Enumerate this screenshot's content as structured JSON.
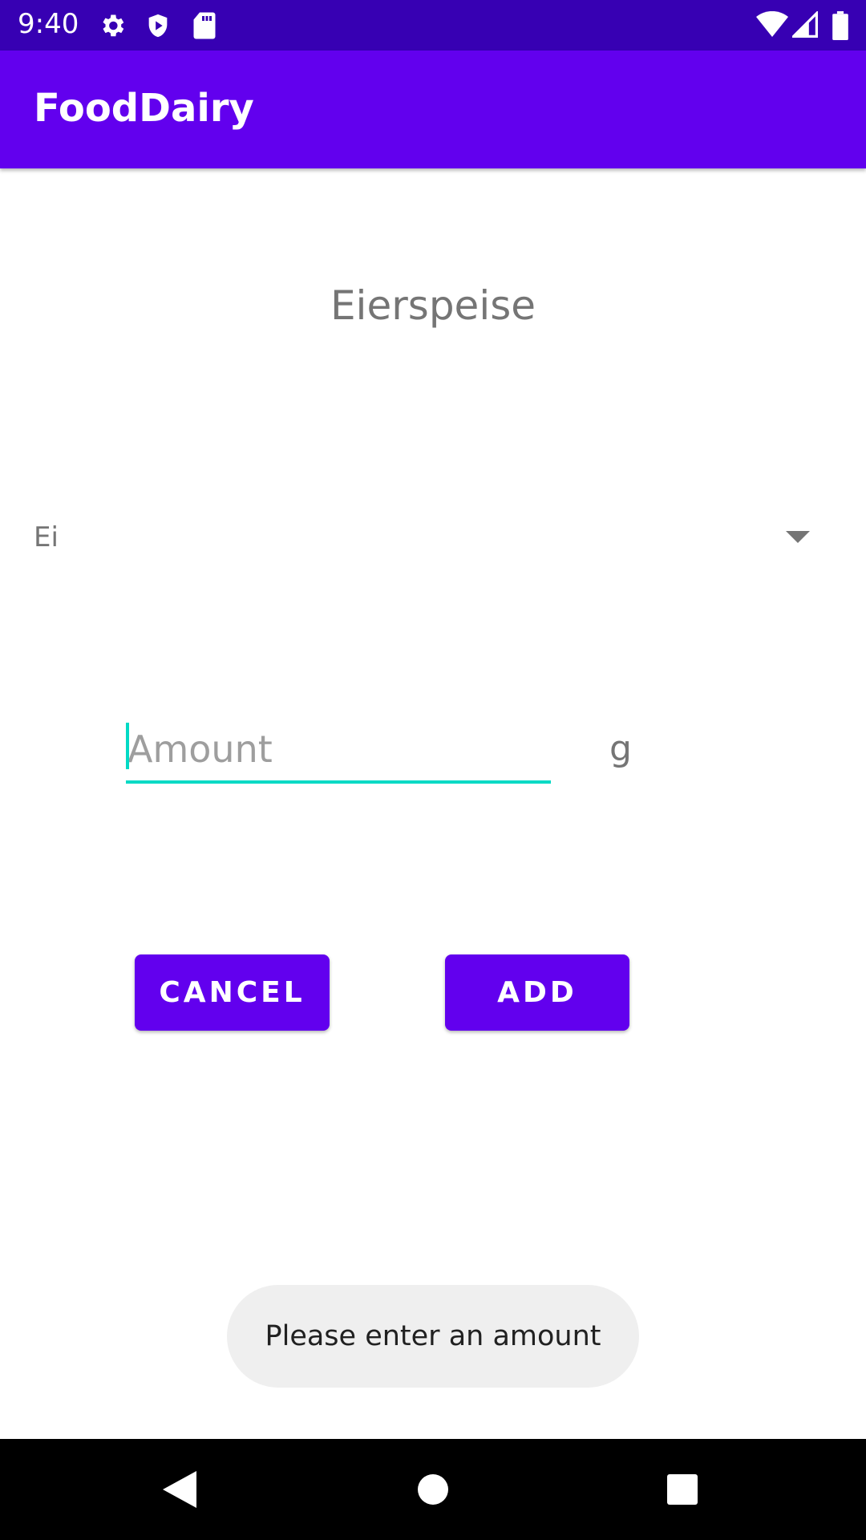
{
  "status_bar": {
    "time": "9:40",
    "icons": [
      "settings-icon",
      "shield-icon",
      "sd-card-icon",
      "wifi-icon",
      "cell-signal-icon",
      "battery-icon"
    ]
  },
  "app_bar": {
    "title": "FoodDairy",
    "color": "#6200EE"
  },
  "recipe": {
    "title": "Eierspeise"
  },
  "ingredient_spinner": {
    "selected": "Ei"
  },
  "amount": {
    "value": "",
    "placeholder": "Amount",
    "unit": "g"
  },
  "buttons": {
    "cancel_label": "CANCEL",
    "add_label": "ADD"
  },
  "toast": {
    "message": "Please enter an amount"
  },
  "colors": {
    "primary": "#6200EE",
    "primary_dark": "#3700B3",
    "accent": "#03DAC5"
  }
}
